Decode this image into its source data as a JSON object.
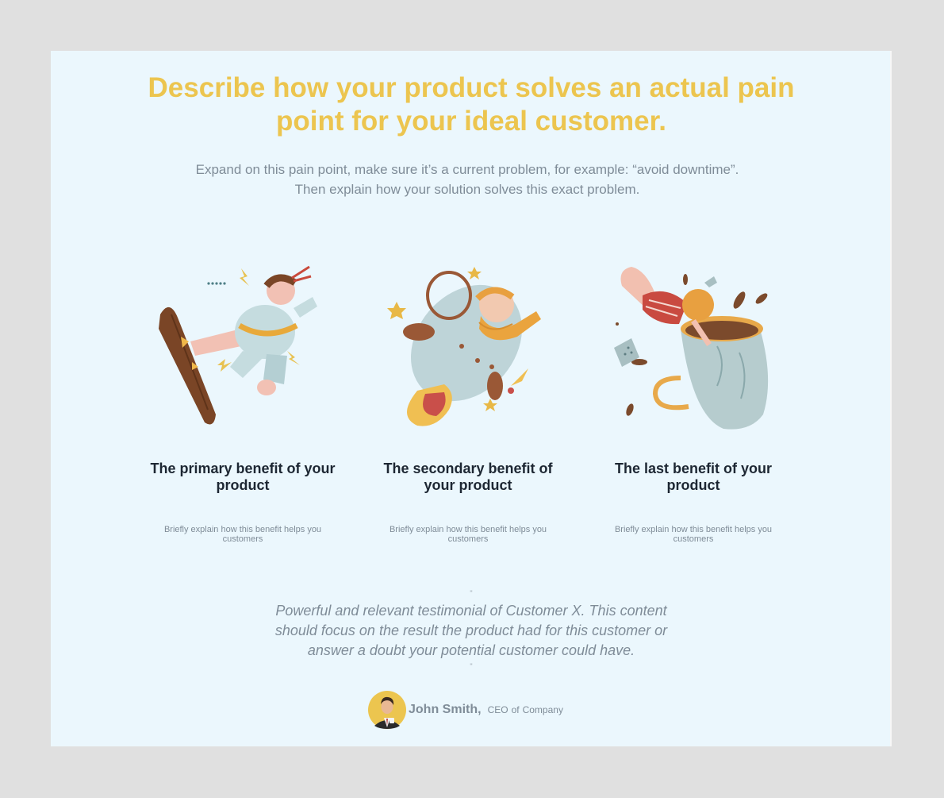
{
  "headline": "Describe how your product solves an actual pain point for your ideal customer.",
  "subheadline": {
    "line1": "Expand on this pain point, make sure it’s a current problem, for example: “avoid downtime”.",
    "line2": "Then explain how your solution solves this exact problem."
  },
  "benefits": [
    {
      "title": "The primary benefit of your product",
      "description": "Briefly explain how this benefit helps you customers",
      "illustration": "karate-kick-illustration"
    },
    {
      "title": "The secondary benefit of your product",
      "description": "Briefly explain how this benefit helps you customers",
      "illustration": "astronaut-rocket-illustration"
    },
    {
      "title": "The last benefit of your product",
      "description": "Briefly explain how this benefit helps you customers",
      "illustration": "coffee-cup-dive-illustration"
    }
  ],
  "testimonial": {
    "open_mark": "\"",
    "text": "Powerful and relevant testimonial of Customer X. This content should focus on the result the product had for this customer or answer a doubt your potential customer could have.",
    "close_mark": "\"",
    "author_name": "John Smith,",
    "author_title": "CEO",
    "of_word": "of",
    "company": "Company"
  },
  "colors": {
    "page_background": "#e0e0e0",
    "card_background": "#ebf7fd",
    "headline": "#ecc54f",
    "body_text": "#7f8c98",
    "benefit_title": "#1d2733"
  }
}
